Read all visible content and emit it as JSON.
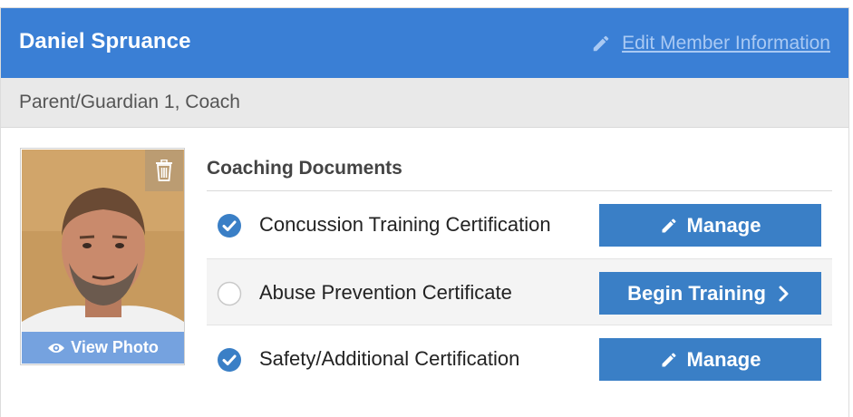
{
  "member": {
    "name": "Daniel Spruance",
    "edit_label": "Edit Member Information",
    "roles": "Parent/Guardian 1, Coach"
  },
  "photo": {
    "view_label": "View Photo"
  },
  "documents": {
    "title": "Coaching Documents",
    "items": [
      {
        "name": "Concussion Training Certification",
        "status": "complete",
        "action": "Manage",
        "action_icon": "pencil-icon"
      },
      {
        "name": "Abuse Prevention Certificate",
        "status": "incomplete",
        "action": "Begin Training",
        "action_icon": "chevron-right-icon"
      },
      {
        "name": "Safety/Additional Certification",
        "status": "complete",
        "action": "Manage",
        "action_icon": "pencil-icon"
      }
    ]
  },
  "colors": {
    "header": "#3a7fd5",
    "button": "#3a7fc6",
    "check": "#3a7fc6"
  }
}
